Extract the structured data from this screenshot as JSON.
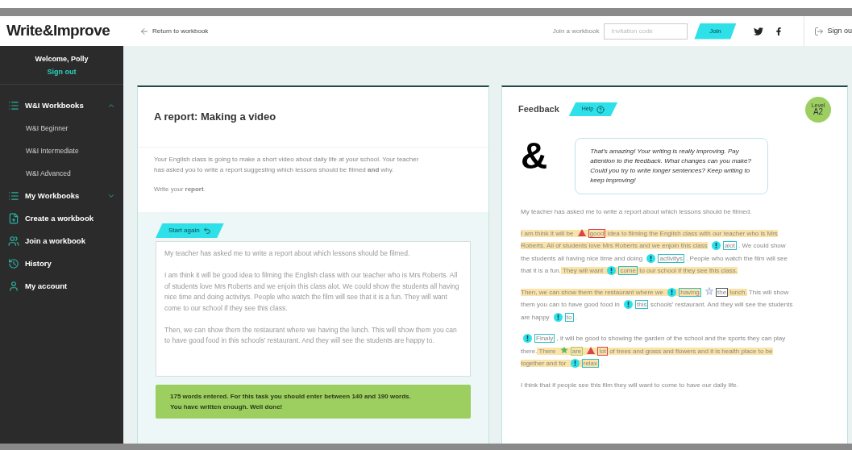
{
  "header": {
    "logo": "Write&Improve",
    "back_link": "Return to workbook",
    "join_label": "Join a workbook",
    "invite_field": {
      "placeholder": "Invitation code"
    },
    "join_button": "Join",
    "sign_out": "Sign ou"
  },
  "sidebar": {
    "welcome": "Welcome, Polly",
    "sign_out": "Sign out",
    "items": [
      {
        "label": "W&I Workbooks",
        "kind": "list",
        "expanded": true,
        "children": [
          {
            "label": "W&I Beginner"
          },
          {
            "label": "W&I Intermediate"
          },
          {
            "label": "W&I Advanced"
          }
        ]
      },
      {
        "label": "My Workbooks",
        "kind": "list",
        "expanded": false
      },
      {
        "label": "Create a workbook",
        "kind": "file"
      },
      {
        "label": "Join a workbook",
        "kind": "group"
      },
      {
        "label": "History",
        "kind": "history"
      },
      {
        "label": "My account",
        "kind": "user"
      }
    ]
  },
  "task": {
    "title": "A report: Making a video",
    "prompt": "Your English class is going to make a short video about daily life at your school. Your teacher has asked you to write a report suggesting which lessons should be filmed **and** why.",
    "instruction": "Write your **report**.",
    "start_again": "Start again",
    "essay": [
      "My teacher has asked me to write a report about which lessons should be filmed.",
      "I am think it will be good idea to filming the English class with our teacher who is Mrs Roberts. All of students love Mrs Roberts and we enjoin this class alot. We could show the students all having nice time and doing activitys. People who watch the film will see that it is a fun. They will want come to our school if they see this class.",
      "Then, we can show them the restaurant where we having the lunch. This will show them you can to have good food in this schools' restaurant. And they will see the students are happy to."
    ],
    "word_count": "175 words entered. For this task you should enter between 140 and 190 words. You have written enough. Well done!"
  },
  "feedback": {
    "title": "Feedback",
    "help": "Help",
    "level_label": "Level",
    "level": "A2",
    "mascot": "&",
    "message": "That's amazing! Your writing is really improving. Pay attention to the feedback. What changes can you make? Could you try to write longer sentences? Keep writing to keep improving!",
    "paragraphs": [
      [
        {
          "kind": "text",
          "text": "My teacher has asked me to write a report about which lessons should be filmed.",
          "highlighted": false
        }
      ],
      [
        {
          "kind": "text",
          "text": "I am think it will be",
          "highlighted": true
        },
        {
          "kind": "error",
          "text": "good",
          "highlighted": true
        },
        {
          "kind": "text",
          "text": "idea to filming the English class with our teacher who is Mrs Roberts. All of students love Mrs Roberts and we enjoin this class",
          "highlighted": true
        },
        {
          "kind": "suggestion",
          "text": "alot",
          "highlighted": false
        },
        {
          "kind": "text",
          "text": ". We could show the students all having nice time and doing",
          "highlighted": false
        },
        {
          "kind": "suggestion",
          "text": "activitys",
          "highlighted": false
        },
        {
          "kind": "text",
          "text": ". People who watch the film will see that it is a fun.",
          "highlighted": false
        },
        {
          "kind": "text",
          "text": "They will want",
          "highlighted": true
        },
        {
          "kind": "suggestion",
          "text": "come",
          "highlighted": true
        },
        {
          "kind": "text",
          "text": "to our school if they see this class.",
          "highlighted": true
        }
      ],
      [
        {
          "kind": "text",
          "text": "Then, we can show them the restaurant where we",
          "highlighted": true
        },
        {
          "kind": "suggestion",
          "text": "having",
          "highlighted": true
        },
        {
          "kind": "tip",
          "text": "the",
          "highlighted": false
        },
        {
          "kind": "text",
          "text": "lunch.",
          "highlighted": true
        },
        {
          "kind": "text",
          "text": "This will show them you can to have good food in",
          "highlighted": false
        },
        {
          "kind": "suggestion",
          "text": "this",
          "highlighted": false
        },
        {
          "kind": "text",
          "text": "schools' restaurant. And they will see the students are happy",
          "highlighted": false
        },
        {
          "kind": "suggestion",
          "text": "to",
          "highlighted": false
        },
        {
          "kind": "text",
          "text": ".",
          "highlighted": false
        }
      ],
      [
        {
          "kind": "suggestion",
          "text": "Finaly",
          "highlighted": false
        },
        {
          "kind": "text",
          "text": ", it will be good to showing the garden of the school and the sports they can play there.",
          "highlighted": false
        },
        {
          "kind": "text",
          "text": "There",
          "highlighted": true
        },
        {
          "kind": "good",
          "text": "are",
          "highlighted": true
        },
        {
          "kind": "error",
          "text": "lot",
          "highlighted": true
        },
        {
          "kind": "text",
          "text": "of trees and grass and flowers and it is health place to be together and for",
          "highlighted": true
        },
        {
          "kind": "suggestion",
          "text": "relax",
          "highlighted": true
        },
        {
          "kind": "text",
          "text": ".",
          "highlighted": false
        }
      ],
      [
        {
          "kind": "text",
          "text": "I think that if people see this film they will want to come to have our daily life.",
          "highlighted": false
        }
      ]
    ]
  }
}
